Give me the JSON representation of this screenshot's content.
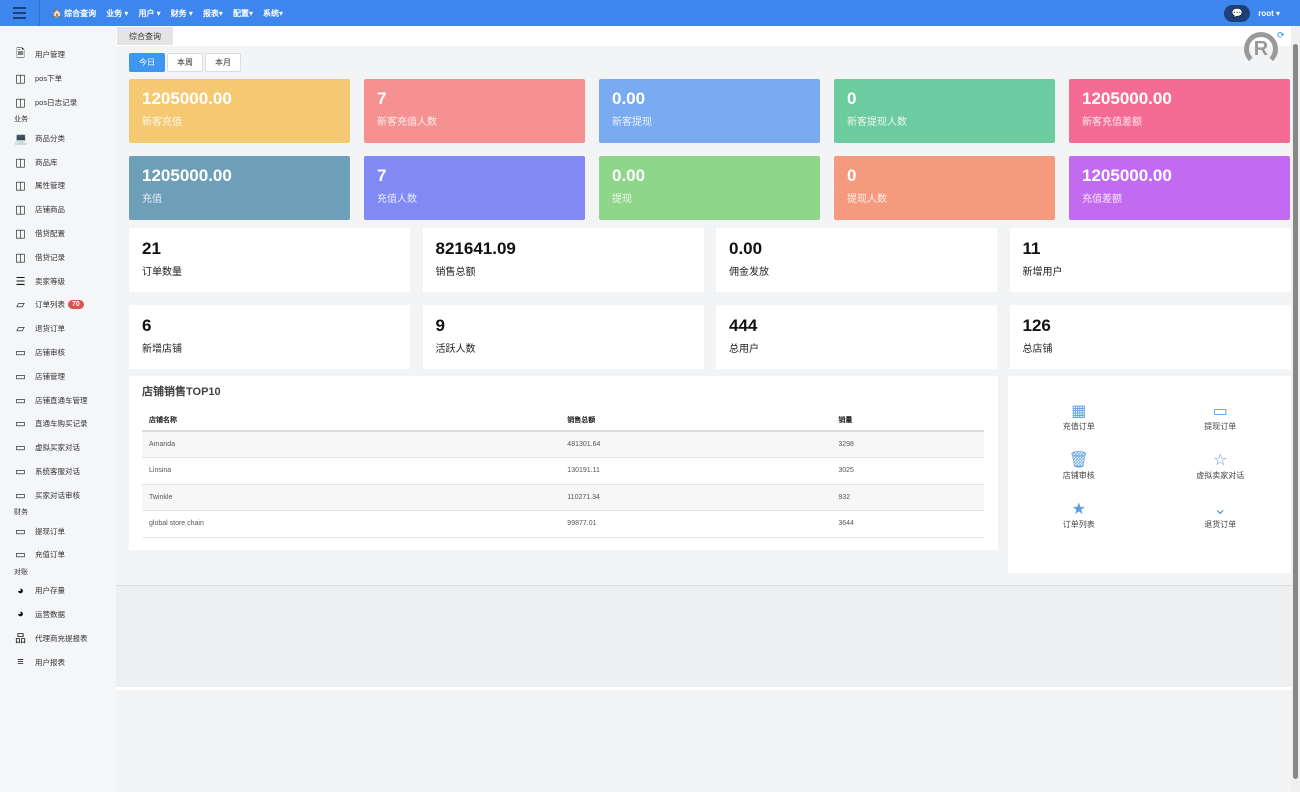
{
  "topnav": {
    "items": [
      "🏠 综合查询",
      "业务 ▾",
      "用户 ▾",
      "财务 ▾",
      "报表▾",
      "配置▾",
      "系统▾"
    ],
    "user": "root ▾"
  },
  "sidebar": [
    {
      "type": "item",
      "icon": "file-icon",
      "glyph": "🗎",
      "label": "用户管理"
    },
    {
      "type": "item",
      "icon": "columns-icon",
      "glyph": "◫",
      "label": "pos下单"
    },
    {
      "type": "item",
      "icon": "columns-icon",
      "glyph": "◫",
      "label": "pos日志记录"
    },
    {
      "type": "section",
      "label": "业务"
    },
    {
      "type": "item",
      "icon": "laptop-icon",
      "glyph": "💻",
      "label": "商品分类"
    },
    {
      "type": "item",
      "icon": "columns-icon",
      "glyph": "◫",
      "label": "商品库"
    },
    {
      "type": "item",
      "icon": "columns-icon",
      "glyph": "◫",
      "label": "属性管理"
    },
    {
      "type": "item",
      "icon": "columns-icon",
      "glyph": "◫",
      "label": "店铺商品"
    },
    {
      "type": "item",
      "icon": "columns-icon",
      "glyph": "◫",
      "label": "借贷配置"
    },
    {
      "type": "item",
      "icon": "columns-icon",
      "glyph": "◫",
      "label": "借贷记录"
    },
    {
      "type": "item",
      "icon": "indent-icon",
      "glyph": "☰",
      "label": "卖家等级"
    },
    {
      "type": "item",
      "icon": "mobile-icon",
      "glyph": "▱",
      "label": "订单列表",
      "badge": "70"
    },
    {
      "type": "item",
      "icon": "mobile-icon",
      "glyph": "▱",
      "label": "退货订单"
    },
    {
      "type": "item",
      "icon": "credit-card-icon",
      "glyph": "▭",
      "label": "店铺审核"
    },
    {
      "type": "item",
      "icon": "credit-card-icon",
      "glyph": "▭",
      "label": "店铺管理"
    },
    {
      "type": "item",
      "icon": "credit-card-icon",
      "glyph": "▭",
      "label": "店铺直通车管理"
    },
    {
      "type": "item",
      "icon": "credit-card-icon",
      "glyph": "▭",
      "label": "直通车购买记录"
    },
    {
      "type": "item",
      "icon": "credit-card-icon",
      "glyph": "▭",
      "label": "虚拟买家对话"
    },
    {
      "type": "item",
      "icon": "credit-card-icon",
      "glyph": "▭",
      "label": "系统客服对话"
    },
    {
      "type": "item",
      "icon": "credit-card-icon",
      "glyph": "▭",
      "label": "买家对话审核"
    },
    {
      "type": "section",
      "label": "财务"
    },
    {
      "type": "item",
      "icon": "credit-card-icon",
      "glyph": "▭",
      "label": "提现订单"
    },
    {
      "type": "item",
      "icon": "credit-card-icon",
      "glyph": "▭",
      "label": "充值订单"
    },
    {
      "type": "section",
      "label": "对账"
    },
    {
      "type": "item",
      "icon": "pie-chart-icon",
      "glyph": "◕",
      "label": "用户存量"
    },
    {
      "type": "item",
      "icon": "pie-chart-icon",
      "glyph": "◕",
      "label": "运营数据"
    },
    {
      "type": "item",
      "icon": "sitemap-icon",
      "glyph": "品",
      "label": "代理商充提报表"
    },
    {
      "type": "item",
      "icon": "align-left-icon",
      "glyph": "≡",
      "label": "用户报表"
    }
  ],
  "breadcrumb": "综合查询",
  "period_buttons": [
    {
      "label": "今日",
      "active": true
    },
    {
      "label": "本周"
    },
    {
      "label": "本月"
    }
  ],
  "color_cards": [
    {
      "value": "1205000.00",
      "label": "新客充值",
      "color": "#f5c971"
    },
    {
      "value": "7",
      "label": "新客充值人数",
      "color": "#f59190"
    },
    {
      "value": "0.00",
      "label": "新客提现",
      "color": "#7aaaf0"
    },
    {
      "value": "0",
      "label": "新客提现人数",
      "color": "#6ccb9f"
    },
    {
      "value": "1205000.00",
      "label": "新客充值差额",
      "color": "#f46c94"
    },
    {
      "value": "1205000.00",
      "label": "充值",
      "color": "#6d9fb8"
    },
    {
      "value": "7",
      "label": "充值人数",
      "color": "#8189f5"
    },
    {
      "value": "0.00",
      "label": "提现",
      "color": "#8fd68a"
    },
    {
      "value": "0",
      "label": "提现人数",
      "color": "#f59a7e"
    },
    {
      "value": "1205000.00",
      "label": "充值差额",
      "color": "#c26bf0"
    }
  ],
  "stats": [
    {
      "value": "21",
      "label": "订单数量"
    },
    {
      "value": "821641.09",
      "label": "销售总额"
    },
    {
      "value": "0.00",
      "label": "佣金发放"
    },
    {
      "value": "11",
      "label": "新增用户"
    },
    {
      "value": "6",
      "label": "新增店铺"
    },
    {
      "value": "9",
      "label": "活跃人数"
    },
    {
      "value": "444",
      "label": "总用户"
    },
    {
      "value": "126",
      "label": "总店铺"
    }
  ],
  "top10": {
    "title": "店铺销售TOP10",
    "columns": [
      "店铺名称",
      "销售总额",
      "销量"
    ],
    "rows": [
      [
        "Amanda",
        "481301.64",
        "3298"
      ],
      [
        "Linsina",
        "130191.11",
        "3025"
      ],
      [
        "Twinkle",
        "110271.34",
        "932"
      ],
      [
        "global store chain",
        "99877.01",
        "3644"
      ]
    ]
  },
  "quick_actions": [
    {
      "icon": "qrcode-icon",
      "glyph": "▦",
      "label": "充值订单"
    },
    {
      "icon": "credit-card-icon",
      "glyph": "▭",
      "label": "提现订单"
    },
    {
      "icon": "trash-icon",
      "glyph": "🗑",
      "label": "店铺审核"
    },
    {
      "icon": "star-outline-icon",
      "glyph": "☆",
      "label": "虚拟卖家对话"
    },
    {
      "icon": "star-icon",
      "glyph": "★",
      "label": "订单列表"
    },
    {
      "icon": "chevron-down-icon",
      "glyph": "⌄",
      "label": "退货订单"
    }
  ]
}
